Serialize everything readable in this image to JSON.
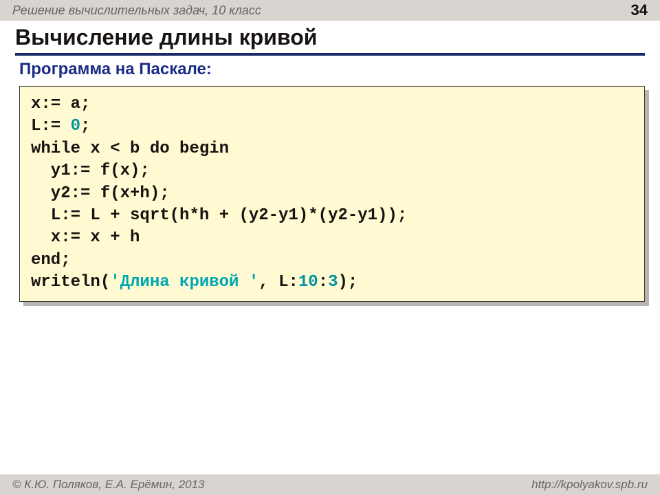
{
  "header": {
    "course": "Решение вычислительных задач, 10 класс",
    "page": "34"
  },
  "title": "Вычисление длины кривой",
  "subtitle": "Программа на Паскале:",
  "code": {
    "l1a": "x:= a;",
    "l2a": "L:= ",
    "l2b": "0",
    "l2c": ";",
    "l3a": "while x < b do begin",
    "l4a": "  y1:= f(x);",
    "l5a": "  y2:= f(x+h);",
    "l6a": "  L:= L + sqrt(h*h + (y2-y1)*(y2-y1));",
    "l7a": "  x:= x + h",
    "l8a": "end;",
    "l9a": "writeln(",
    "l9b": "'Длина кривой '",
    "l9c": ", L:",
    "l9d": "10",
    "l9e": ":",
    "l9f": "3",
    "l9g": ");"
  },
  "footer": {
    "left": "© К.Ю. Поляков, Е.А. Ерёмин, 2013",
    "right": "http://kpolyakov.spb.ru"
  }
}
